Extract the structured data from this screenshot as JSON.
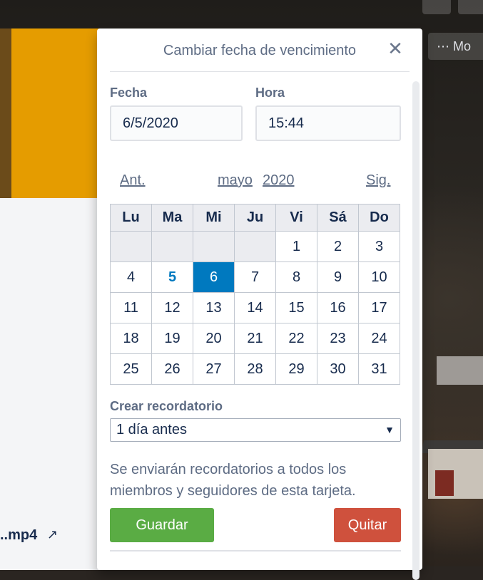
{
  "background": {
    "more_button_label": "Mo",
    "more_icon": "ellipsis-icon",
    "attachment_name": "..mp4",
    "attachment_arrow": "↗"
  },
  "popover": {
    "title": "Cambiar fecha de vencimiento",
    "close_glyph": "✕",
    "date_label": "Fecha",
    "date_value": "6/5/2020",
    "time_label": "Hora",
    "time_value": "15:44",
    "prev_label": "Ant.",
    "month_label": "mayo",
    "year_label": "2020",
    "next_label": "Sig.",
    "weekdays": [
      "Lu",
      "Ma",
      "Mi",
      "Ju",
      "Vi",
      "Sá",
      "Do"
    ],
    "weeks": [
      [
        "",
        "",
        "",
        "",
        "1",
        "2",
        "3"
      ],
      [
        "4",
        "5",
        "6",
        "7",
        "8",
        "9",
        "10"
      ],
      [
        "11",
        "12",
        "13",
        "14",
        "15",
        "16",
        "17"
      ],
      [
        "18",
        "19",
        "20",
        "21",
        "22",
        "23",
        "24"
      ],
      [
        "25",
        "26",
        "27",
        "28",
        "29",
        "30",
        "31"
      ]
    ],
    "today_day": "5",
    "selected_day": "6",
    "reminder_label": "Crear recordatorio",
    "reminder_value": "1 día antes",
    "help_text": "Se enviarán recordatorios a todos los miembros y seguidores de esta tarjeta.",
    "save_label": "Guardar",
    "remove_label": "Quitar"
  },
  "colors": {
    "accent": "#0079bf",
    "save": "#5aac44",
    "remove": "#cf513d",
    "cover": "#e59c00"
  }
}
